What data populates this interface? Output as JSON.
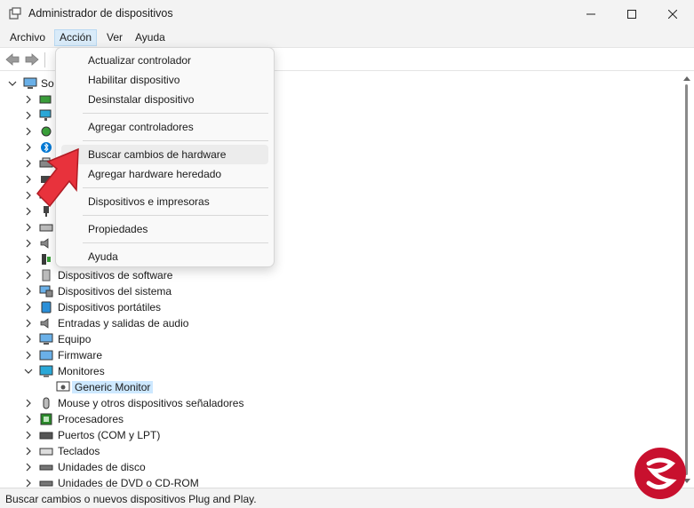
{
  "window": {
    "title": "Administrador de dispositivos"
  },
  "menubar": {
    "items": [
      "Archivo",
      "Acción",
      "Ver",
      "Ayuda"
    ]
  },
  "tree": {
    "root_label": "So",
    "categories": [
      "Dispositivos de software",
      "Dispositivos del sistema",
      "Dispositivos portátiles",
      "Entradas y salidas de audio",
      "Equipo",
      "Firmware",
      "Monitores",
      "Generic Monitor",
      "Mouse y otros dispositivos señaladores",
      "Procesadores",
      "Puertos (COM y LPT)",
      "Teclados",
      "Unidades de disco",
      "Unidades de DVD o CD-ROM"
    ]
  },
  "action_menu": {
    "items": [
      "Actualizar controlador",
      "Habilitar dispositivo",
      "Desinstalar dispositivo",
      "Agregar controladores",
      "Buscar cambios de hardware",
      "Agregar hardware heredado",
      "Dispositivos e impresoras",
      "Propiedades",
      "Ayuda"
    ]
  },
  "statusbar": {
    "text": "Buscar cambios o nuevos dispositivos Plug and Play."
  },
  "colors": {
    "accent": "#0078d4",
    "selection": "#cde8ff",
    "arrow": "#e8323c",
    "watermark": "#c8102e"
  }
}
